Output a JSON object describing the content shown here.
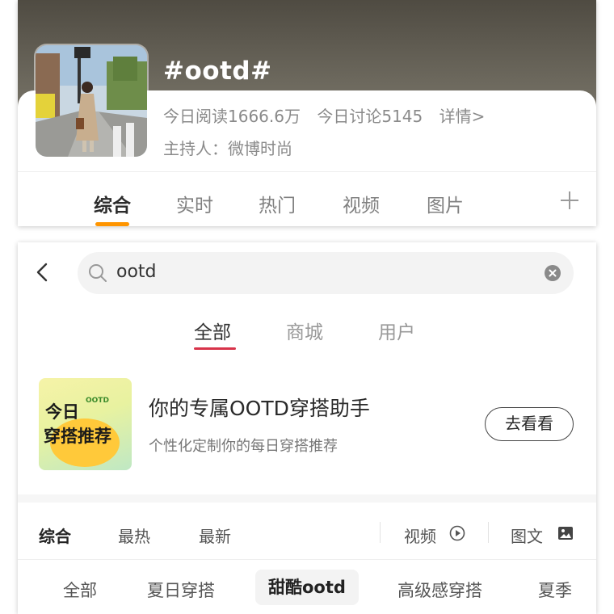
{
  "topic": {
    "title": "#ootd#",
    "read_today": "今日阅读1666.6万",
    "discuss_today": "今日讨论5145",
    "details_link": "详情>",
    "host": "主持人：微博时尚",
    "tabs": [
      "综合",
      "实时",
      "热门",
      "视频",
      "图片"
    ],
    "active_tab": "综合",
    "accent_color": "#ff9500"
  },
  "search": {
    "query": "ootd",
    "scope_tabs": [
      "全部",
      "商城",
      "用户"
    ],
    "active_scope": "全部",
    "accent_color": "#d8334a"
  },
  "promo": {
    "image_line1": "今日",
    "image_logo": "OOTD",
    "image_line2": "穿搭推荐",
    "title": "你的专属OOTD穿搭助手",
    "subtitle": "个性化定制你的每日穿搭推荐",
    "button_label": "去看看"
  },
  "sort_bar": {
    "tabs": [
      "综合",
      "最热",
      "最新"
    ],
    "active": "综合",
    "video_label": "视频",
    "image_text_label": "图文"
  },
  "filter_chips": [
    "全部",
    "夏日穿搭",
    "甜酷ootd",
    "高级感穿搭",
    "夏季"
  ],
  "active_chip": "甜酷ootd"
}
